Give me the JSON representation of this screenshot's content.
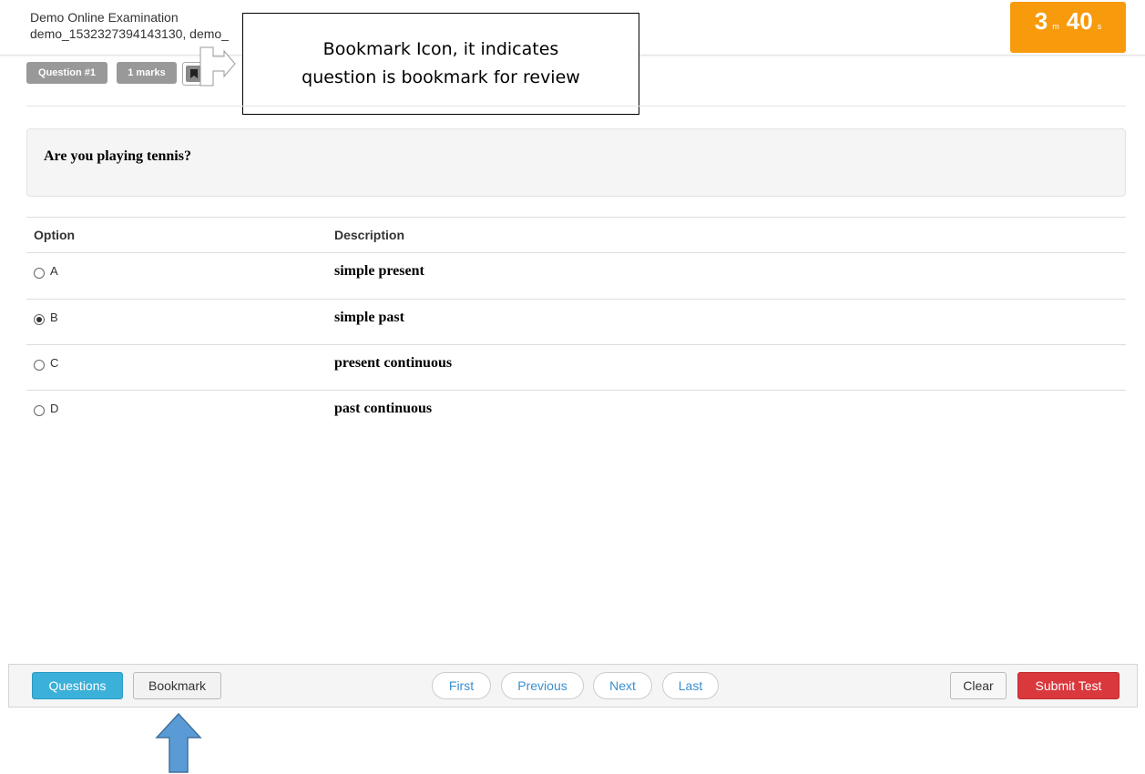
{
  "header": {
    "exam_title": "Demo Online Examination",
    "exam_subtitle": "demo_1532327394143130, demo_",
    "timer": {
      "minutes": "3",
      "minutes_unit": "m",
      "seconds": "40",
      "seconds_unit": "s"
    }
  },
  "question_meta": {
    "number_badge": "Question #1",
    "marks_badge": "1 marks",
    "bookmark_icon": "bookmark-icon"
  },
  "callout": {
    "line1": "Bookmark Icon, it indicates",
    "line2": "question is bookmark for review"
  },
  "question": {
    "text": "Are you playing tennis?"
  },
  "options_table": {
    "headers": {
      "option": "Option",
      "description": "Description"
    },
    "rows": [
      {
        "letter": "A",
        "description": "simple present",
        "selected": false
      },
      {
        "letter": "B",
        "description": "simple past",
        "selected": true
      },
      {
        "letter": "C",
        "description": "present continuous",
        "selected": false
      },
      {
        "letter": "D",
        "description": "past continuous",
        "selected": false
      }
    ]
  },
  "footer": {
    "questions_label": "Questions",
    "bookmark_label": "Bookmark",
    "first_label": "First",
    "previous_label": "Previous",
    "next_label": "Next",
    "last_label": "Last",
    "clear_label": "Clear",
    "submit_label": "Submit Test"
  },
  "colors": {
    "timer_bg": "#f79a0c",
    "questions_button": "#3bb0d9",
    "submit_button": "#d9383d",
    "annotation_arrow": "#5b9bd5"
  }
}
